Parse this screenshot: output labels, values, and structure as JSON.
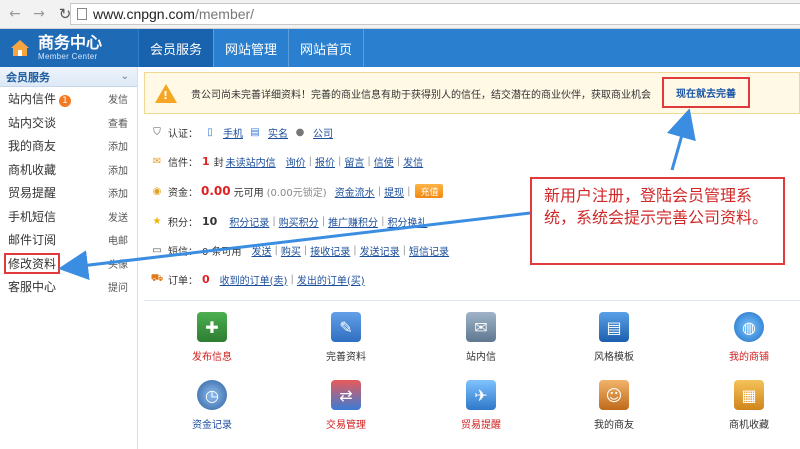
{
  "browser": {
    "url_host": "www.cnpgn.com",
    "url_path": "/member/"
  },
  "header": {
    "logo_title": "商务中心",
    "logo_subtitle": "Member Center",
    "tabs": [
      {
        "label": "会员服务",
        "active": true
      },
      {
        "label": "网站管理",
        "active": false
      },
      {
        "label": "网站首页",
        "active": false
      }
    ]
  },
  "sidebar": {
    "section_title": "会员服务",
    "items": [
      {
        "label": "站内信件",
        "action": "发信",
        "badge": "1"
      },
      {
        "label": "站内交谈",
        "action": "查看"
      },
      {
        "label": "我的商友",
        "action": "添加"
      },
      {
        "label": "商机收藏",
        "action": "添加"
      },
      {
        "label": "贸易提醒",
        "action": "添加"
      },
      {
        "label": "手机短信",
        "action": "发送"
      },
      {
        "label": "邮件订阅",
        "action": "电邮"
      },
      {
        "label": "修改资料",
        "action": "头像"
      },
      {
        "label": "客服中心",
        "action": "提问"
      }
    ]
  },
  "notice": {
    "text": "贵公司尚未完善详细资料！完善的商业信息有助于获得别人的信任，结交潜在的商业伙伴，获取商业机会",
    "link": "现在就去完善"
  },
  "info": {
    "auth_label": "认证：",
    "auth_items": [
      "手机",
      "实名",
      "公司"
    ],
    "mail_label": "信件：",
    "mail_count": "1",
    "mail_unit": "封",
    "mail_links": [
      "未读站内信",
      "询价",
      "报价",
      "留言",
      "信使",
      "发信"
    ],
    "fund_label": "资金：",
    "fund_amount": "0.00",
    "fund_unit": "元可用",
    "fund_locked": "(0.00元锁定)",
    "fund_links": [
      "资金流水",
      "提现"
    ],
    "fund_button": "充值",
    "score_label": "积分：",
    "score_value": "10",
    "score_links": [
      "积分记录",
      "购买积分",
      "推广赚积分",
      "积分换礼"
    ],
    "sms_label": "短信：",
    "sms_value": "0 条可用",
    "sms_links": [
      "发送",
      "购买",
      "接收记录",
      "发送记录",
      "短信记录"
    ],
    "order_label": "订单：",
    "order_value": "0",
    "order_links": [
      "收到的订单(卖)",
      "发出的订单(买)"
    ]
  },
  "apps": [
    {
      "label": "发布信息",
      "color": "#d02020",
      "icon": "publish-icon"
    },
    {
      "label": "完善资料",
      "color": "#333333",
      "icon": "edit-profile-icon"
    },
    {
      "label": "站内信",
      "color": "#333333",
      "icon": "inbox-icon"
    },
    {
      "label": "风格模板",
      "color": "#333333",
      "icon": "template-icon"
    },
    {
      "label": "我的商铺",
      "color": "#d02020",
      "icon": "shop-icon"
    },
    {
      "label": "资金记录",
      "color": "#1d4f9b",
      "icon": "fund-icon"
    },
    {
      "label": "交易管理",
      "color": "#d02020",
      "icon": "trade-icon"
    },
    {
      "label": "贸易提醒",
      "color": "#d02020",
      "icon": "alert-icon"
    },
    {
      "label": "我的商友",
      "color": "#333333",
      "icon": "friends-icon"
    },
    {
      "label": "商机收藏",
      "color": "#333333",
      "icon": "favorite-icon"
    }
  ],
  "callout": {
    "text": "新用户注册，登陆会员管理系统，系统会提示完善公司资料。"
  }
}
